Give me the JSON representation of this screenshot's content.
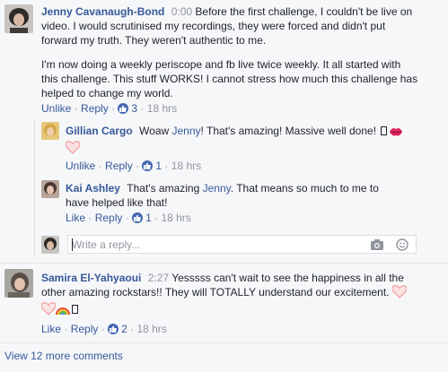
{
  "comments": [
    {
      "author": "Jenny Cavanaugh-Bond",
      "video_time": "0:00",
      "text_p1": "Before the first challenge, I couldn't be live on video. I would scrutinised my recordings, they were forced and didn't put forward my truth. They weren't authentic to me.",
      "text_p2": "I'm now doing a weekly periscope and fb live twice weekly. It all started with this challenge. This stuff WORKS! I cannot stress how much this challenge has helped to change my world.",
      "action_like": "Unlike",
      "action_reply": "Reply",
      "like_count": "3",
      "timestamp": "18 hrs",
      "replies": [
        {
          "author": "Gillian Cargo",
          "text_before": "Woaw",
          "mention": "Jenny",
          "text_after": "! That's amazing! Massive well done!",
          "action_like": "Unlike",
          "action_reply": "Reply",
          "like_count": "1",
          "timestamp": "18 hrs"
        },
        {
          "author": "Kai Ashley",
          "text_before": "That's amazing",
          "mention": "Jenny",
          "text_after": ". That means so much to me to have helped like that!",
          "action_like": "Like",
          "action_reply": "Reply",
          "like_count": "1",
          "timestamp": "18 hrs"
        }
      ],
      "reply_placeholder": "Write a reply...",
      "camera_icon": "camera-icon",
      "emoji_icon": "smiley-icon"
    },
    {
      "author": "Samira El-Yahyaoui",
      "video_time": "2:27",
      "text": "Yesssss can't wait to see the happiness in all the other amazing rockstars!! They will TOTALLY understand our excitement.",
      "action_like": "Like",
      "action_reply": "Reply",
      "like_count": "2",
      "timestamp": "18 hrs"
    }
  ],
  "view_more": "View 12 more comments",
  "colors": {
    "link": "#365899",
    "meta": "#90949c",
    "like_badge": "#4267b2",
    "heart": "#f4a7a7",
    "lips": "#e0245e"
  }
}
